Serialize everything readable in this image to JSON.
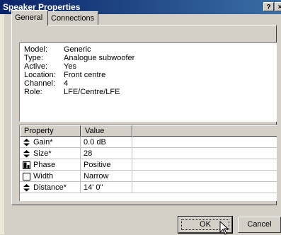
{
  "window": {
    "title": "Speaker Properties",
    "help_glyph": "?",
    "close_glyph": "×"
  },
  "tabs": [
    {
      "label": "General"
    },
    {
      "label": "Connections"
    }
  ],
  "info": [
    {
      "label": "Model:",
      "value": "Generic"
    },
    {
      "label": "Type:",
      "value": "Analogue subwoofer"
    },
    {
      "label": "Active:",
      "value": "Yes"
    },
    {
      "label": "Location:",
      "value": "Front centre"
    },
    {
      "label": "Channel:",
      "value": "4"
    },
    {
      "label": "Role:",
      "value": "LFE/Centre/LFE"
    }
  ],
  "grid": {
    "headers": [
      "Property",
      "Value",
      ""
    ],
    "rows": [
      {
        "icon": "spinner-icon",
        "property": "Gain*",
        "value": "0.0 dB"
      },
      {
        "icon": "spinner-icon",
        "property": "Size*",
        "value": "28"
      },
      {
        "icon": "phase-toggle-icon",
        "property": "Phase",
        "value": "Positive"
      },
      {
        "icon": "checkbox-icon",
        "property": "Width",
        "value": "Narrow"
      },
      {
        "icon": "spinner-icon",
        "property": "Distance*",
        "value": "14' 0\""
      }
    ]
  },
  "buttons": {
    "ok": "OK",
    "cancel": "Cancel"
  }
}
